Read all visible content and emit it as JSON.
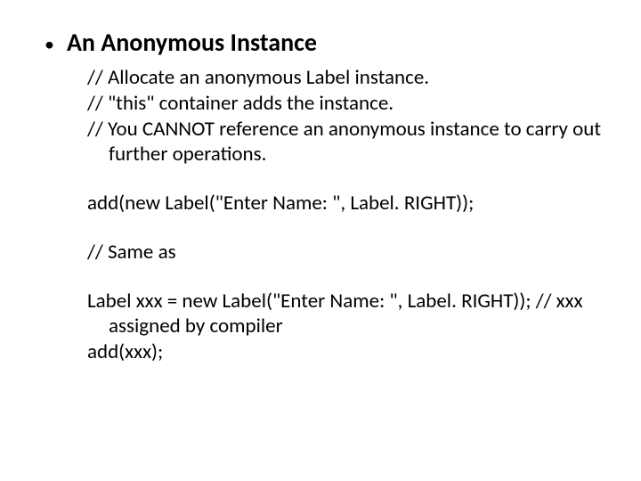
{
  "heading": "An Anonymous Instance",
  "lines": {
    "comment1": "// Allocate an anonymous Label instance.",
    "comment2": "// \"this\" container adds the instance.",
    "comment3": "// You CANNOT reference an anonymous instance to carry out further operations.",
    "code1": "add(new Label(\"Enter Name: \", Label. RIGHT));",
    "comment4": "// Same as",
    "code2": "Label xxx = new Label(\"Enter Name: \", Label. RIGHT)); // xxx assigned by compiler",
    "code3": "add(xxx);"
  }
}
